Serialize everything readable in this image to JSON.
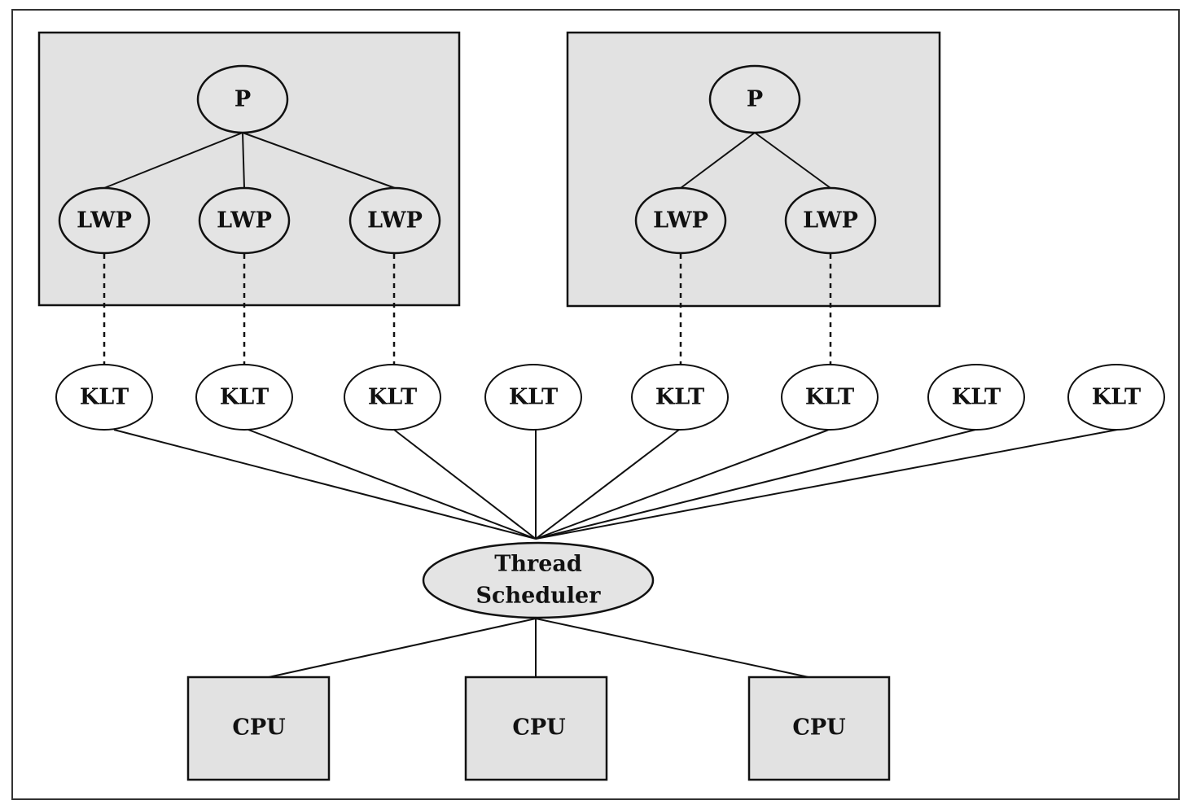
{
  "diagram": {
    "processes": [
      {
        "label": "P",
        "lwps": [
          "LWP",
          "LWP",
          "LWP"
        ]
      },
      {
        "label": "P",
        "lwps": [
          "LWP",
          "LWP"
        ]
      }
    ],
    "klts": [
      "KLT",
      "KLT",
      "KLT",
      "KLT",
      "KLT",
      "KLT",
      "KLT",
      "KLT"
    ],
    "scheduler": {
      "line1": "Thread",
      "line2": "Scheduler"
    },
    "cpus": [
      "CPU",
      "CPU",
      "CPU"
    ],
    "colors": {
      "shade": "#e2e2e2",
      "stroke": "#111111"
    }
  }
}
